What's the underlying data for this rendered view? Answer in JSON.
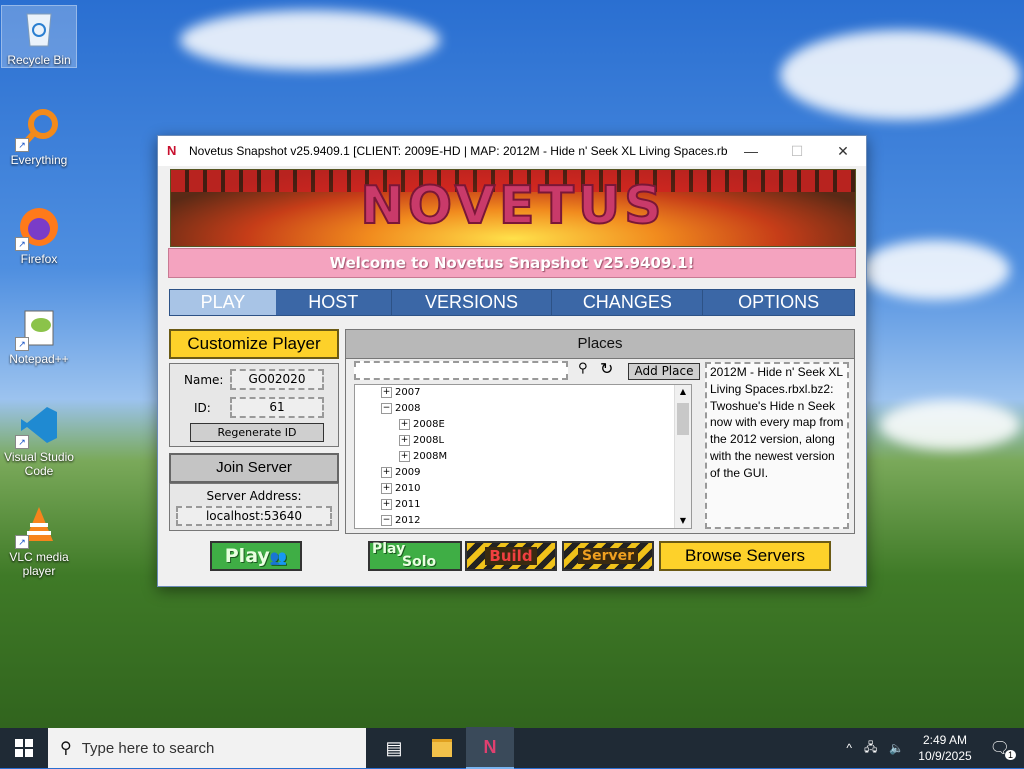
{
  "desktop": {
    "icons": [
      {
        "label": "Recycle Bin",
        "icon": "recycle-bin-icon"
      },
      {
        "label": "Everything",
        "icon": "everything-search-icon"
      },
      {
        "label": "Firefox",
        "icon": "firefox-icon"
      },
      {
        "label": "Notepad++",
        "icon": "notepad-plus-plus-icon"
      },
      {
        "label": "Visual Studio Code",
        "icon": "vscode-icon"
      },
      {
        "label": "VLC media player",
        "icon": "vlc-icon"
      }
    ]
  },
  "window": {
    "title": "Novetus Snapshot v25.9409.1 [CLIENT: 2009E-HD | MAP: 2012M - Hide n' Seek XL Living Spaces.rbxl....",
    "minimize": "—",
    "maximize": "☐",
    "close": "✕",
    "logo_text": "NOVETUS",
    "welcome": "Welcome to Novetus Snapshot v25.9409.1!",
    "tabs": [
      "PLAY",
      "HOST",
      "VERSIONS",
      "CHANGES",
      "OPTIONS"
    ],
    "active_tab": "PLAY",
    "customize_player": "Customize Player",
    "name_label": "Name:",
    "name_value": "GO02020",
    "id_label": "ID:",
    "id_value": "61",
    "regenerate_id": "Regenerate ID",
    "join_server": "Join Server",
    "server_address_label": "Server Address:",
    "server_address_value": "localhost:53640",
    "places_title": "Places",
    "search_value": "",
    "add_place": "Add Place",
    "tree": [
      {
        "label": "2007",
        "expander": "+",
        "indent": 0
      },
      {
        "label": "2008",
        "expander": "−",
        "indent": 0
      },
      {
        "label": "2008E",
        "expander": "+",
        "indent": 1
      },
      {
        "label": "2008L",
        "expander": "+",
        "indent": 1
      },
      {
        "label": "2008M",
        "expander": "+",
        "indent": 1
      },
      {
        "label": "2009",
        "expander": "+",
        "indent": 0
      },
      {
        "label": "2010",
        "expander": "+",
        "indent": 0
      },
      {
        "label": "2011",
        "expander": "+",
        "indent": 0
      },
      {
        "label": "2012",
        "expander": "−",
        "indent": 0
      }
    ],
    "description": "2012M - Hide n' Seek XL Living Spaces.rbxl.bz2: Twoshue's Hide n Seek now with every map from the 2012 version, along with the newest version of the GUI.",
    "play_button": "Play",
    "play_solo_top": "Play",
    "play_solo_bottom": "Solo",
    "build_button": "Build",
    "server_button": "Server",
    "browse_servers": "Browse Servers"
  },
  "taskbar": {
    "search_placeholder": "Type here to search",
    "time": "2:49 AM",
    "date": "10/9/2025",
    "notification_count": "1"
  },
  "colors": {
    "accent_tab": "#3b67a6",
    "active_tab": "#a8c4e6",
    "welcome_bg": "#f4a3bf",
    "yellow_button": "#fdd12a"
  }
}
